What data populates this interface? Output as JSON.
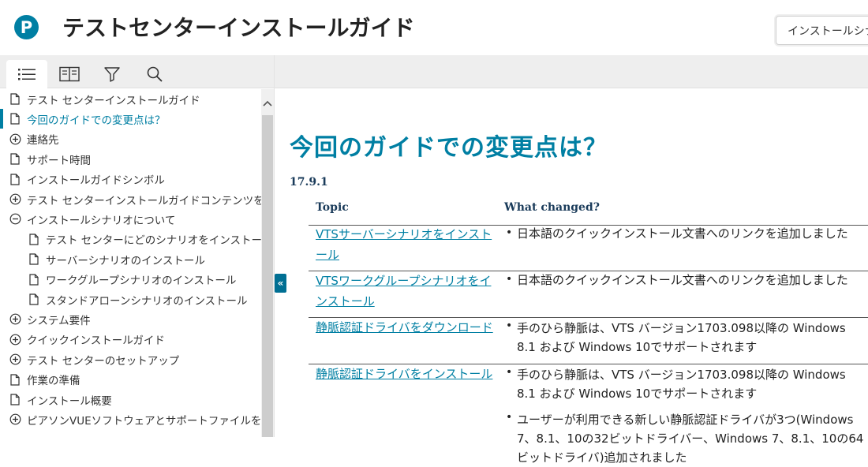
{
  "header": {
    "title": "テストセンターインストールガイド",
    "search_value": "インストールシナリ",
    "logo_letter": "P",
    "accent_color": "#007fa3"
  },
  "sidebar": {
    "tabs": [
      {
        "name": "toc-icon",
        "active": true
      },
      {
        "name": "book-icon",
        "active": false
      },
      {
        "name": "filter-icon",
        "active": false
      },
      {
        "name": "search-icon",
        "active": false
      }
    ],
    "items": [
      {
        "label": "テスト センターインストールガイド",
        "icon": "page-icon",
        "level": 0
      },
      {
        "label": "今回のガイドでの変更点は？",
        "icon": "page-icon",
        "level": 0,
        "selected": true
      },
      {
        "label": "連絡先",
        "icon": "expand-icon",
        "level": 0
      },
      {
        "label": "サポート時間",
        "icon": "page-icon",
        "level": 0
      },
      {
        "label": "インストールガイドシンボル",
        "icon": "page-icon",
        "level": 0
      },
      {
        "label": "テスト センターインストールガイドコンテンツをフィルタリング",
        "icon": "expand-icon",
        "level": 0
      },
      {
        "label": "インストールシナリオについて",
        "icon": "collapse-icon",
        "level": 0
      },
      {
        "label": "テスト センターにどのシナリオをインストールできますか？",
        "icon": "page-icon",
        "level": 1
      },
      {
        "label": "サーバーシナリオのインストール",
        "icon": "page-icon",
        "level": 1
      },
      {
        "label": "ワークグループシナリオのインストール",
        "icon": "page-icon",
        "level": 1
      },
      {
        "label": "スタンドアローンシナリオのインストール",
        "icon": "page-icon",
        "level": 1
      },
      {
        "label": "システム要件",
        "icon": "expand-icon",
        "level": 0
      },
      {
        "label": "クイックインストールガイド",
        "icon": "expand-icon",
        "level": 0
      },
      {
        "label": "テスト センターのセットアップ",
        "icon": "expand-icon",
        "level": 0
      },
      {
        "label": "作業の準備",
        "icon": "page-icon",
        "level": 0
      },
      {
        "label": "インストール概要",
        "icon": "page-icon",
        "level": 0
      },
      {
        "label": "ピアソンVUEソフトウェアとサポートファイルをダウンロード",
        "icon": "expand-icon",
        "level": 0
      }
    ],
    "collapse_label": "«"
  },
  "main": {
    "title": "今回のガイドでの変更点は？",
    "version": "17.9.1",
    "col_topic": "Topic",
    "col_changed": "What changed?",
    "rows": [
      {
        "topic": "VTSサーバーシナリオをインストール",
        "changes": [
          "日本語のクイックインストール文書へのリンクを追加しました"
        ]
      },
      {
        "topic": "VTSワークグループシナリオをインストール",
        "changes": [
          "日本語のクイックインストール文書へのリンクを追加しました"
        ]
      },
      {
        "topic": "静脈認証ドライバをダウンロード",
        "changes": [
          "手のひら静脈は、VTS バージョン1703.098以降の Windows 8.1 および Windows 10でサポートされます"
        ]
      },
      {
        "topic": "静脈認証ドライバをインストール",
        "changes": [
          "手のひら静脈は、VTS バージョン1703.098以降の Windows 8.1 および Windows 10でサポートされます",
          "ユーザーが利用できる新しい静脈認証ドライバが3つ(Windows 7、8.1、10の32ビットドライバー、Windows 7、8.1、10の64ビットドライバ)追加されました"
        ]
      }
    ]
  }
}
